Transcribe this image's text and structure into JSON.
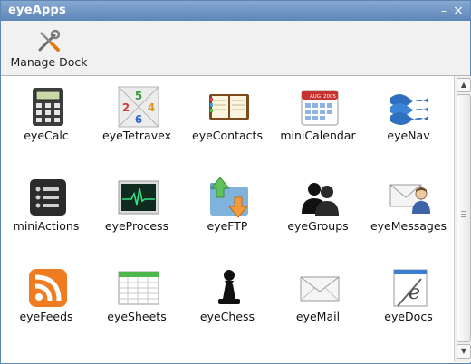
{
  "window": {
    "title": "eyeApps"
  },
  "toolbar": {
    "manage_dock_label": "Manage Dock"
  },
  "apps": [
    {
      "label": "eyeCalc"
    },
    {
      "label": "eyeTetravex"
    },
    {
      "label": "eyeContacts"
    },
    {
      "label": "miniCalendar"
    },
    {
      "label": "eyeNav"
    },
    {
      "label": "miniActions"
    },
    {
      "label": "eyeProcess"
    },
    {
      "label": "eyeFTP"
    },
    {
      "label": "eyeGroups"
    },
    {
      "label": "eyeMessages"
    },
    {
      "label": "eyeFeeds"
    },
    {
      "label": "eyeSheets"
    },
    {
      "label": "eyeChess"
    },
    {
      "label": "eyeMail"
    },
    {
      "label": "eyeDocs"
    }
  ],
  "icons": {
    "tetravex_numbers": [
      "5",
      "2",
      "4",
      "6"
    ],
    "calendar_month": "AUG",
    "calendar_year": "2005"
  },
  "colors": {
    "titlebar": "#6f94c3",
    "toolbar": "#f1f1f1",
    "scrollbar": "#f0f0f0"
  }
}
